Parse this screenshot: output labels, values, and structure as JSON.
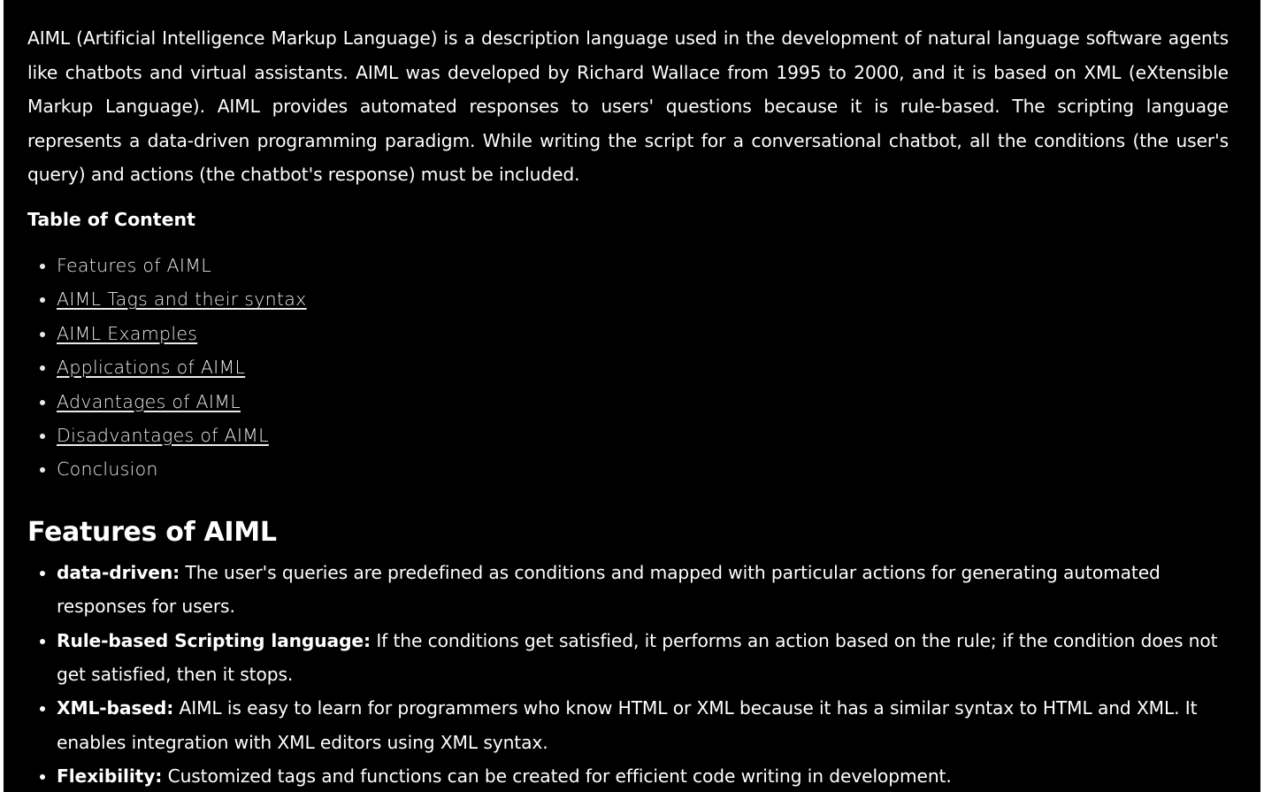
{
  "intro": "AIML (Artificial Intelligence Markup Language) is a description language used in the development of natural language software agents like chatbots and virtual assistants. AIML was developed by Richard Wallace from 1995 to 2000, and it is based on XML (eXtensible Markup Language). AIML provides automated responses to users' questions because it is rule-based. The scripting language represents a data-driven programming paradigm. While writing the script for a conversational chatbot, all the conditions (the user's query) and actions (the chatbot's response) must be included.",
  "toc": {
    "heading": "Table of Content",
    "items": [
      {
        "label": "Features of AIML"
      },
      {
        "label": "AIML Tags and their syntax"
      },
      {
        "label": "AIML Examples"
      },
      {
        "label": "Applications of AIML"
      },
      {
        "label": "Advantages of AIML"
      },
      {
        "label": "Disadvantages of AIML"
      },
      {
        "label": "Conclusion"
      }
    ]
  },
  "features": {
    "heading": "Features of AIML",
    "items": [
      {
        "term": "data-driven:",
        "text": " The user's queries are predefined as conditions and mapped with particular actions for generating automated responses for users."
      },
      {
        "term": "Rule-based Scripting language:",
        "text": " If the conditions get satisfied, it performs an action based on the rule; if the condition does not get satisfied, then it stops."
      },
      {
        "term": "XML-based:",
        "text": " AIML is easy to learn for programmers who know HTML or XML because it has a similar syntax to HTML and XML. It enables integration with XML editors using XML syntax."
      },
      {
        "term": "Flexibility:",
        "text": " Customized tags and functions can be created for efficient code writing in development."
      }
    ]
  }
}
